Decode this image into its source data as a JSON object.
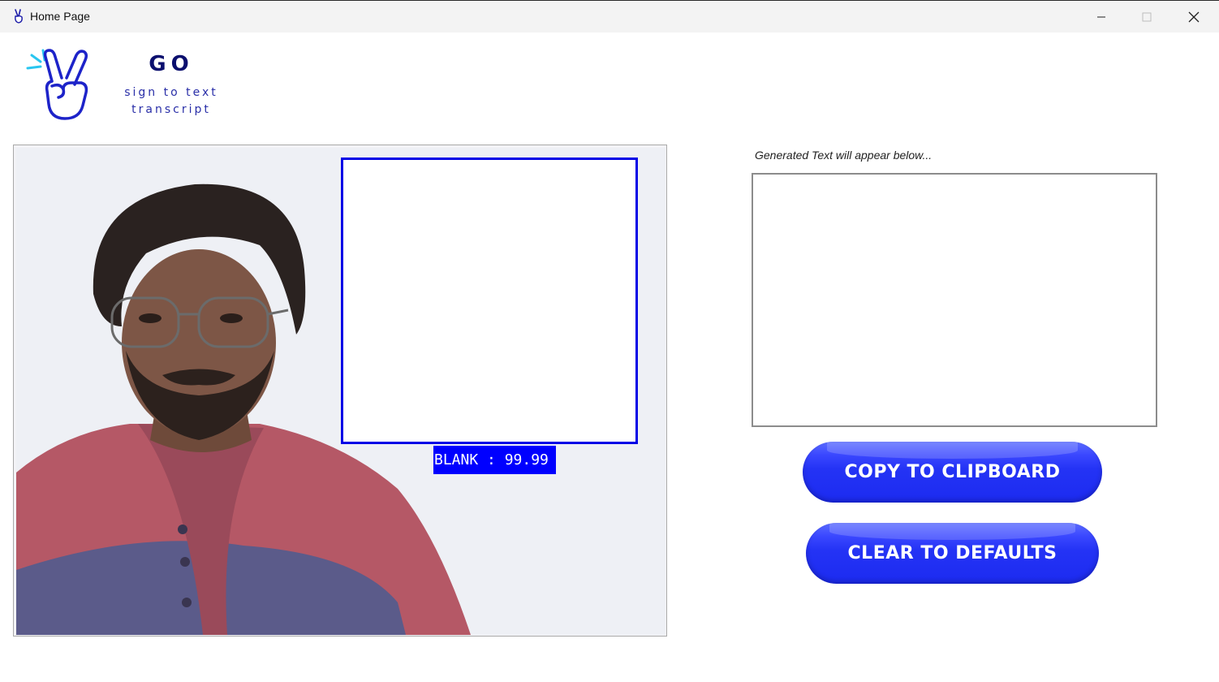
{
  "window": {
    "title": "Home Page",
    "controls": [
      "minimize-icon",
      "maximize-icon",
      "close-icon"
    ]
  },
  "logo": {
    "name": "GO",
    "tagline_line1": "sign to text",
    "tagline_line2": "transcript",
    "icon": "peace-sign-hand-icon",
    "colors": {
      "primary": "#0b0f6e",
      "accent": "#2a2fa8",
      "highlight": "#29c6f0"
    }
  },
  "camera": {
    "prediction_label": "BLANK : 99.99",
    "roi_color": "#0000e6"
  },
  "output": {
    "label": "Generated Text will appear below...",
    "text": ""
  },
  "buttons": {
    "copy_label": "COPY TO CLIPBOARD",
    "clear_label": "CLEAR TO DEFAULTS",
    "color": "#2433f5"
  }
}
